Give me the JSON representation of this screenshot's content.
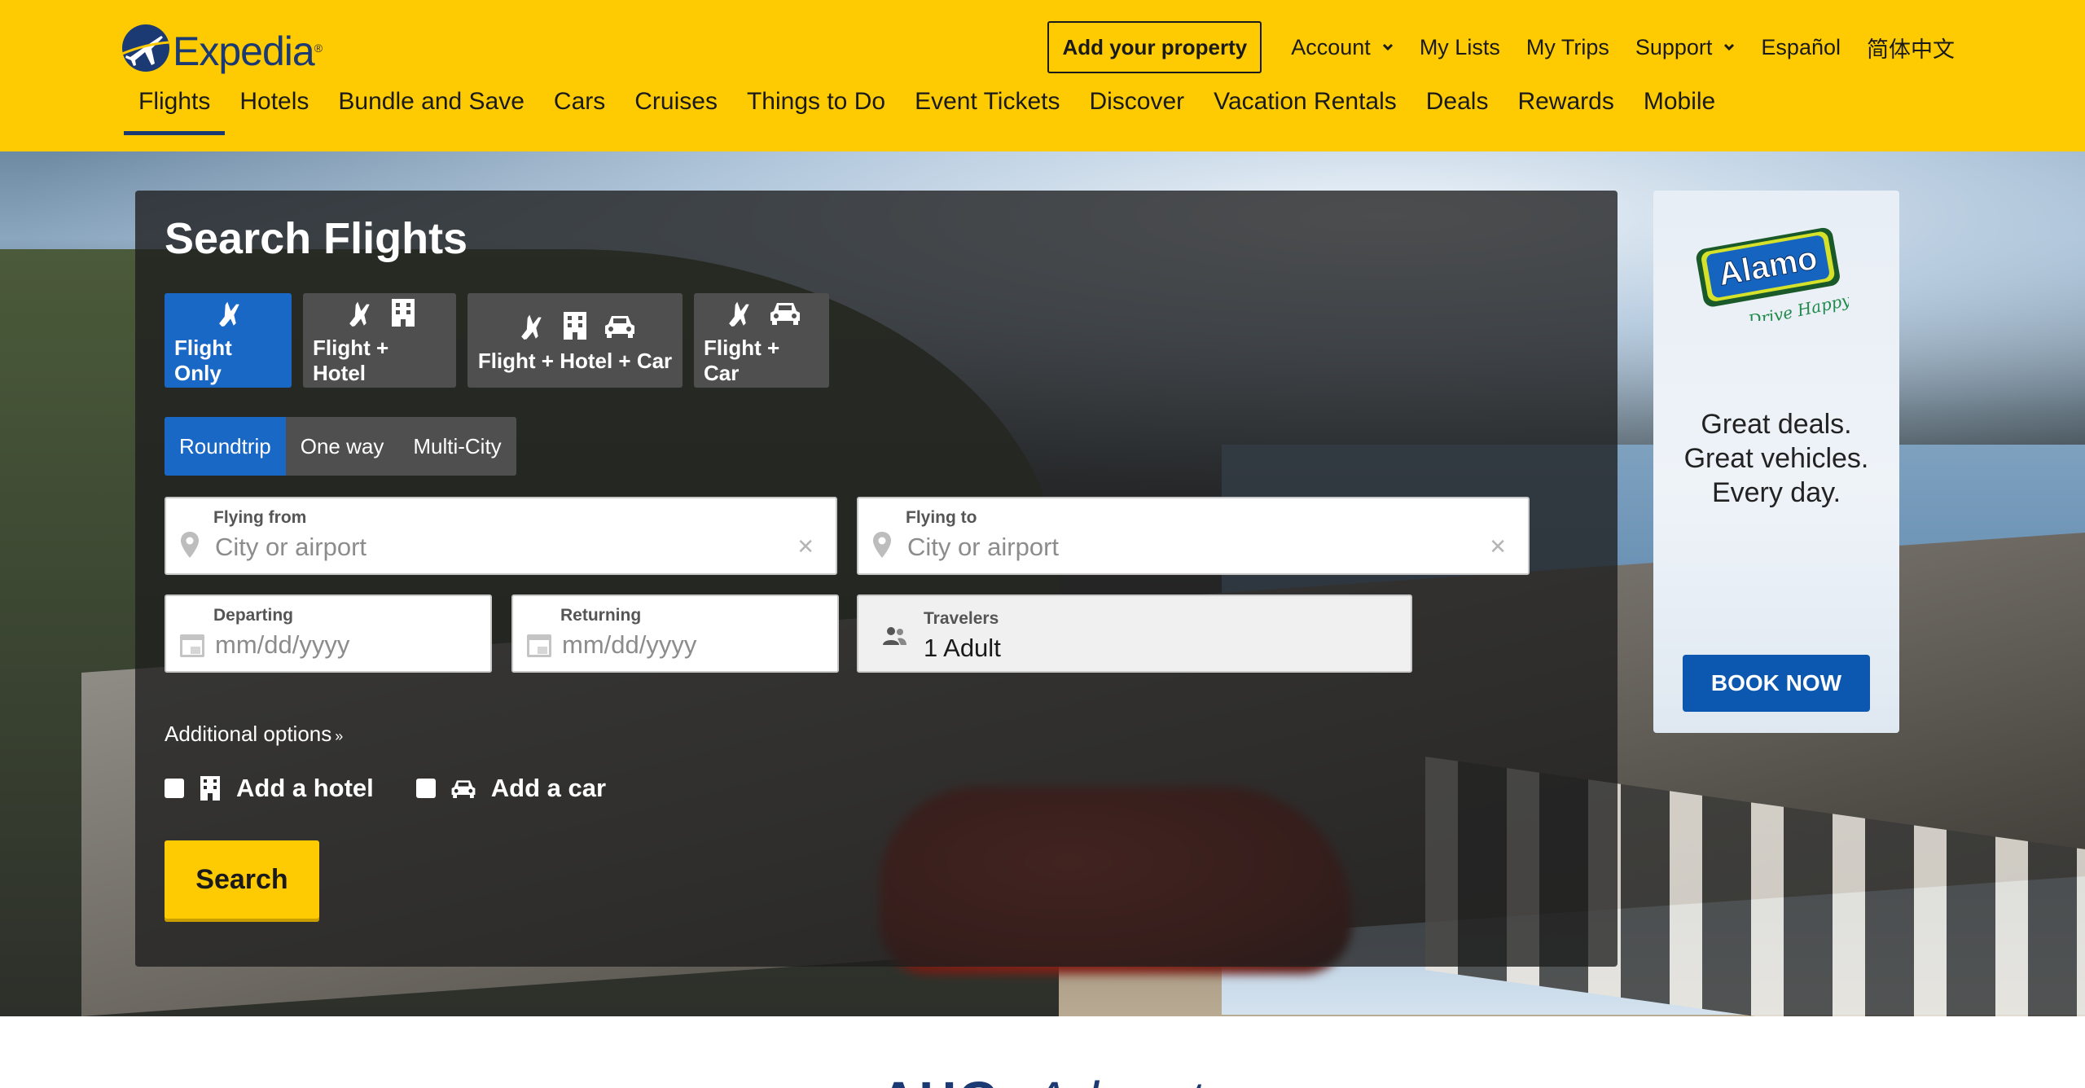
{
  "brand": {
    "name": "Expedia",
    "primary_color": "#fecb02",
    "navy": "#1b3a73",
    "accent_blue": "#1a68c5"
  },
  "topnav": {
    "add_property": "Add your property",
    "account": "Account",
    "my_lists": "My Lists",
    "my_trips": "My Trips",
    "support": "Support",
    "espanol": "Español",
    "chinese": "简体中文"
  },
  "mainnav": {
    "items": [
      "Flights",
      "Hotels",
      "Bundle and Save",
      "Cars",
      "Cruises",
      "Things to Do",
      "Event Tickets",
      "Discover",
      "Vacation Rentals",
      "Deals",
      "Rewards",
      "Mobile"
    ],
    "active": "Flights"
  },
  "search": {
    "title": "Search Flights",
    "product_tabs": [
      {
        "label": "Flight Only",
        "icons": [
          "plane-icon"
        ],
        "active": true
      },
      {
        "label": "Flight + Hotel",
        "icons": [
          "plane-icon",
          "building-icon"
        ],
        "active": false
      },
      {
        "label": "Flight + Hotel + Car",
        "icons": [
          "plane-icon",
          "building-icon",
          "car-icon"
        ],
        "active": false
      },
      {
        "label": "Flight + Car",
        "icons": [
          "plane-icon",
          "car-icon"
        ],
        "active": false
      }
    ],
    "trip_types": [
      "Roundtrip",
      "One way",
      "Multi-City"
    ],
    "trip_type_selected": "Roundtrip",
    "flying_from": {
      "label": "Flying from",
      "placeholder": "City or airport"
    },
    "flying_to": {
      "label": "Flying to",
      "placeholder": "City or airport"
    },
    "departing": {
      "label": "Departing",
      "placeholder": "mm/dd/yyyy"
    },
    "returning": {
      "label": "Returning",
      "placeholder": "mm/dd/yyyy"
    },
    "travelers": {
      "label": "Travelers",
      "value": "1 Adult"
    },
    "additional_options": "Additional options",
    "add_hotel": "Add a hotel",
    "add_car": "Add a car",
    "search_button": "Search"
  },
  "ad": {
    "logo_text": "Alamo",
    "tagline": "Drive Happy",
    "line1": "Great deals.",
    "line2": "Great vehicles.",
    "line3": "Every day.",
    "cta": "BOOK NOW"
  }
}
